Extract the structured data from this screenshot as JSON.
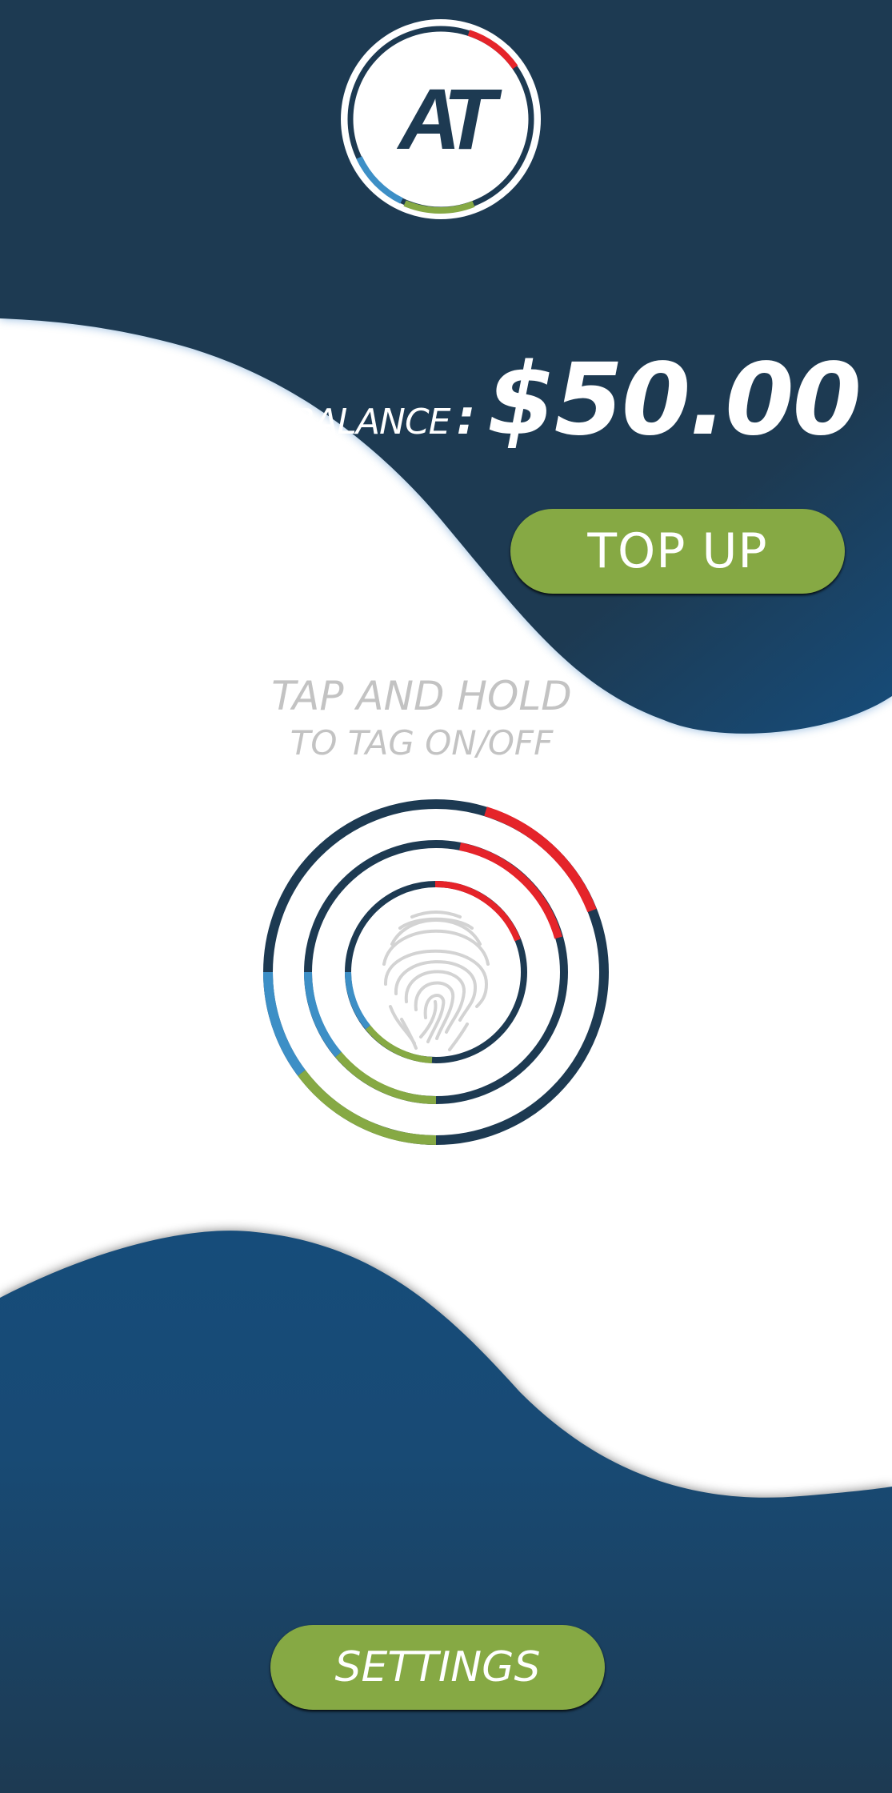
{
  "logo": {
    "text": "AT",
    "colors": {
      "navy": "#1d3a52",
      "red": "#e5242a",
      "blue": "#3d8fc6",
      "green": "#86a944"
    }
  },
  "balance": {
    "label": "BALANCE",
    "separator": ":",
    "amount": "$50.00"
  },
  "top_up_button": {
    "label": "TOP UP"
  },
  "tag_instructions": {
    "line1": "TAP AND HOLD",
    "line2": "TO TAG ON/OFF"
  },
  "fingerprint_scanner": {
    "icon": "fingerprint-icon"
  },
  "settings_button": {
    "label": "SETTINGS"
  },
  "theme": {
    "background_navy": "#1d3a52",
    "wave_blue": "#164c7a",
    "button_green": "#86a944",
    "hint_gray": "#c3c3c3"
  }
}
